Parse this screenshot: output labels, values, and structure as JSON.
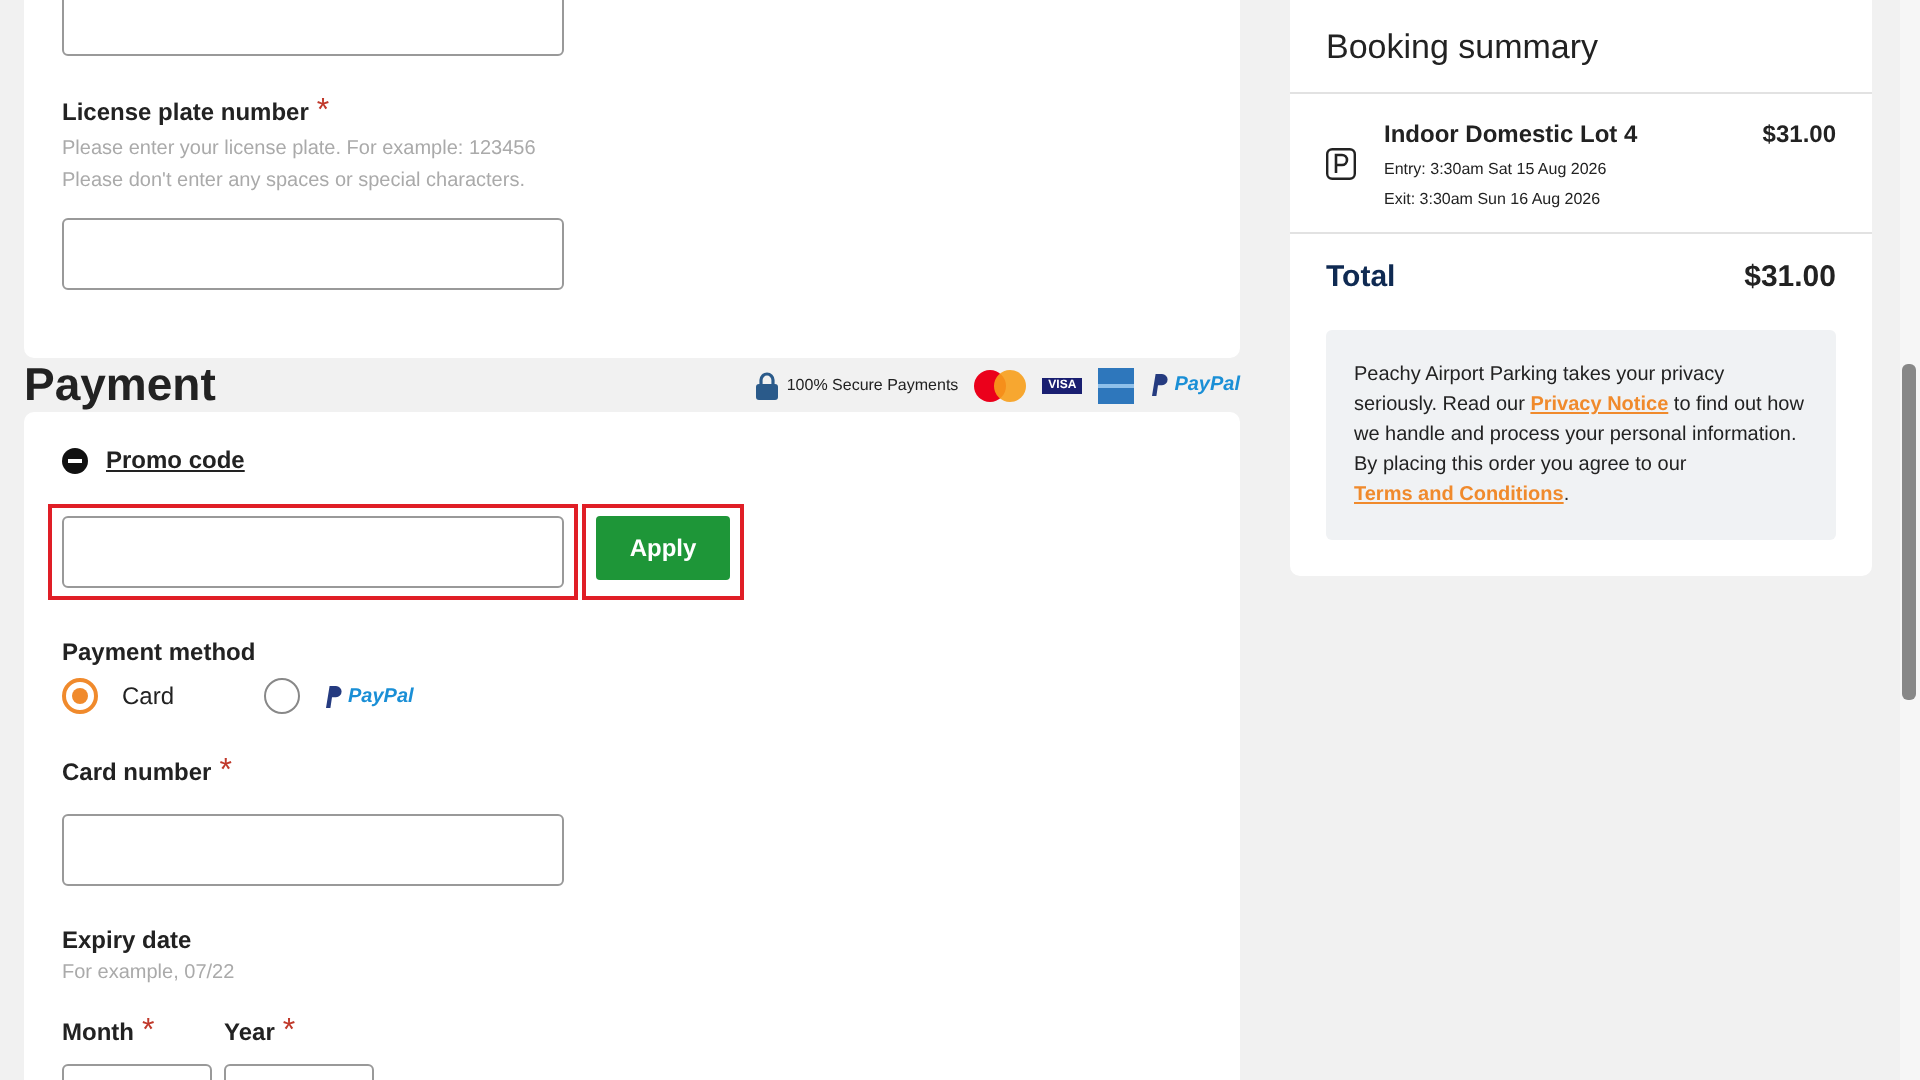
{
  "vehicle_card": {
    "license_plate": {
      "label": "License plate number",
      "required_mark": "*",
      "hints": [
        "Please enter your license plate. For example: 123456",
        "Please don't enter any spaces or special characters."
      ]
    }
  },
  "payment": {
    "title": "Payment",
    "secure_label": "100% Secure Payments",
    "logos": [
      {
        "kind": "mastercard"
      },
      {
        "kind": "visa",
        "text": "VISA"
      },
      {
        "kind": "amex"
      },
      {
        "kind": "paypal",
        "text": "PayPal"
      }
    ],
    "promo": {
      "label": "Promo code",
      "expanded": true,
      "field_highlighted": true,
      "button": "Apply",
      "button_highlighted": true
    },
    "method_label": "Payment method",
    "methods": [
      {
        "kind": "card",
        "label": "Card",
        "selected": true
      },
      {
        "kind": "paypal",
        "label": "PayPal",
        "selected": false
      }
    ],
    "card_number": {
      "label": "Card number",
      "required_mark": "*"
    },
    "expiry": {
      "label": "Expiry date",
      "hint": "For example, 07/22",
      "fields": [
        {
          "label": "Month",
          "required_mark": "*"
        },
        {
          "label": "Year",
          "required_mark": "*"
        }
      ]
    }
  },
  "summary": {
    "title": "Booking summary",
    "item": {
      "name": "Indoor Domestic Lot 4",
      "price": "$31.00",
      "entry": "Entry: 3:30am Sat 15 Aug 2026",
      "exit": "Exit: 3:30am Sun 16 Aug 2026"
    },
    "total_label": "Total",
    "total": "$31.00",
    "privacy_text": [
      "Peachy Airport Parking takes your privacy seriously. Read our ",
      {
        "link": "Privacy Notice"
      },
      " to find out how we handle and process your personal information. By placing this order you agree to our ",
      {
        "link": "Terms and Conditions"
      },
      "."
    ]
  }
}
